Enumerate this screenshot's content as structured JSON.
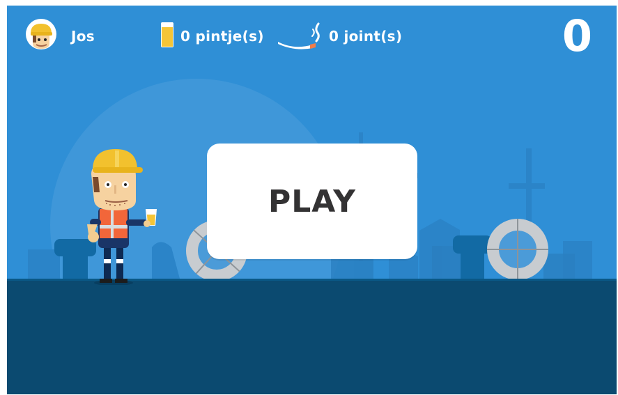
{
  "hud": {
    "player_name": "Jos",
    "beer_count_label": "0 pintje(s)",
    "joint_count_label": "0 joint(s)",
    "score": "0"
  },
  "menu": {
    "play_label": "PLAY"
  },
  "icons": {
    "avatar": "player-avatar-icon",
    "beer": "beer-glass-icon",
    "joint": "joint-smoke-icon"
  },
  "colors": {
    "sky": "#2f8fd6",
    "ground": "#0b4a70",
    "button": "#ffffff",
    "button_text": "#333233",
    "hud_text": "#ffffff",
    "helmet": "#f2c12e",
    "vest": "#f2663a"
  }
}
